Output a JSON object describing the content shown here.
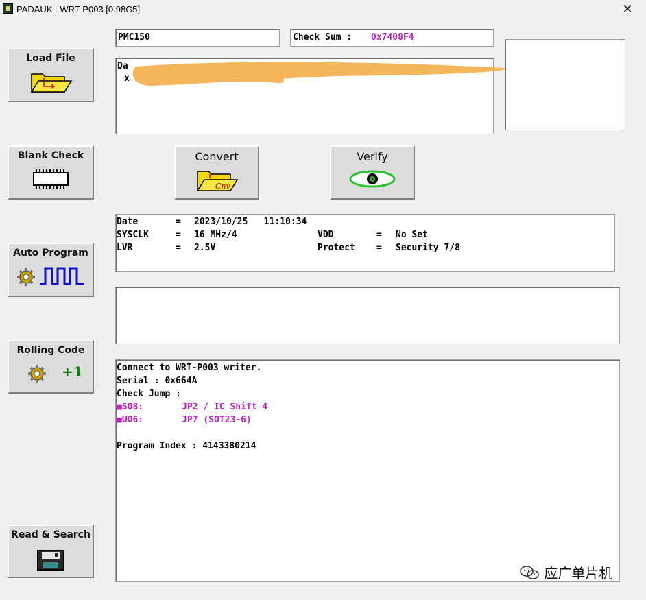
{
  "window": {
    "title": "PADAUK : WRT-P003 [0.98G5]",
    "close_glyph": "✕"
  },
  "header": {
    "ic_name": "PMC150",
    "checksum_label": "Check Sum : ",
    "checksum_value": "0x7408F4"
  },
  "file_box": {
    "line1": "Da",
    "line2": "x"
  },
  "buttons": {
    "load_file": "Load File",
    "blank_check": "Blank Check",
    "convert": "Convert",
    "verify": "Verify",
    "auto_program": "Auto Program",
    "rolling_code": "Rolling Code",
    "rolling_plus": "+1",
    "read_search": "Read & Search"
  },
  "info": {
    "date_label": "Date",
    "date_value": "2023/10/25   11:10:34",
    "sysclk_label": "SYSCLK",
    "sysclk_value": "16 MHz/4",
    "vdd_label": "VDD",
    "vdd_value": "No Set",
    "lvr_label": "LVR",
    "lvr_value": "2.5V",
    "protect_label": "Protect",
    "protect_value": "Security 7/8",
    "eq": "="
  },
  "log": {
    "line1": "Connect to WRT-P003 writer.",
    "line2": "Serial : 0x664A",
    "line3": "Check Jump :",
    "jump1_code": "■S08:",
    "jump1_value": "JP2 / IC Shift 4",
    "jump2_code": "■U06:",
    "jump2_value": "JP7 (SOT23-6)",
    "line6": "Program Index : 4143380214"
  },
  "watermark": {
    "text": "应广单片机"
  },
  "colors": {
    "magenta": "#c020c0",
    "redaction": "#f4b65a",
    "folder": "#f5d800",
    "wave": "#1010d0",
    "eye": "#30c030"
  }
}
